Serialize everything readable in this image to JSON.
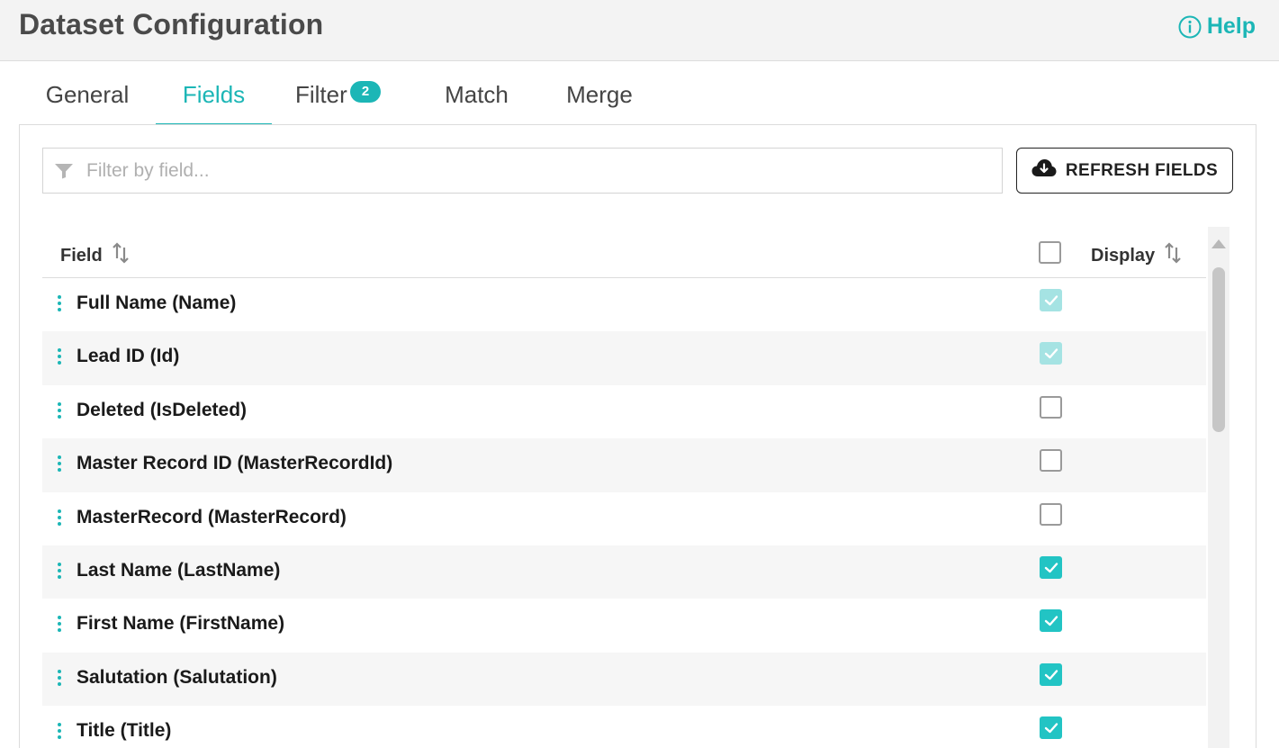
{
  "header": {
    "title": "Dataset Configuration",
    "help_label": "Help",
    "help_icon": "info-icon"
  },
  "tabs": [
    {
      "label": "General",
      "active": false
    },
    {
      "label": "Fields",
      "active": true
    },
    {
      "label": "Filter",
      "active": false,
      "badge": "2"
    },
    {
      "label": "Match",
      "active": false
    },
    {
      "label": "Merge",
      "active": false
    }
  ],
  "search": {
    "placeholder": "Filter by field...",
    "value": "",
    "icon": "filter-icon"
  },
  "refresh_button": {
    "label": "REFRESH FIELDS",
    "icon": "cloud-download-icon"
  },
  "table": {
    "columns": {
      "field": "Field",
      "display": "Display"
    },
    "select_all_checked": false,
    "rows": [
      {
        "label": "Full Name (Name)",
        "state": "checked-disabled"
      },
      {
        "label": "Lead ID (Id)",
        "state": "checked-disabled"
      },
      {
        "label": "Deleted (IsDeleted)",
        "state": "unchecked"
      },
      {
        "label": "Master Record ID (MasterRecordId)",
        "state": "unchecked"
      },
      {
        "label": "MasterRecord (MasterRecord)",
        "state": "unchecked"
      },
      {
        "label": "Last Name (LastName)",
        "state": "checked"
      },
      {
        "label": "First Name (FirstName)",
        "state": "checked"
      },
      {
        "label": "Salutation (Salutation)",
        "state": "checked"
      },
      {
        "label": "Title (Title)",
        "state": "checked"
      }
    ]
  },
  "colors": {
    "accent": "#1cb6b6",
    "checkbox_checked": "#22c4c4",
    "checkbox_disabled": "#a5e3e3"
  }
}
